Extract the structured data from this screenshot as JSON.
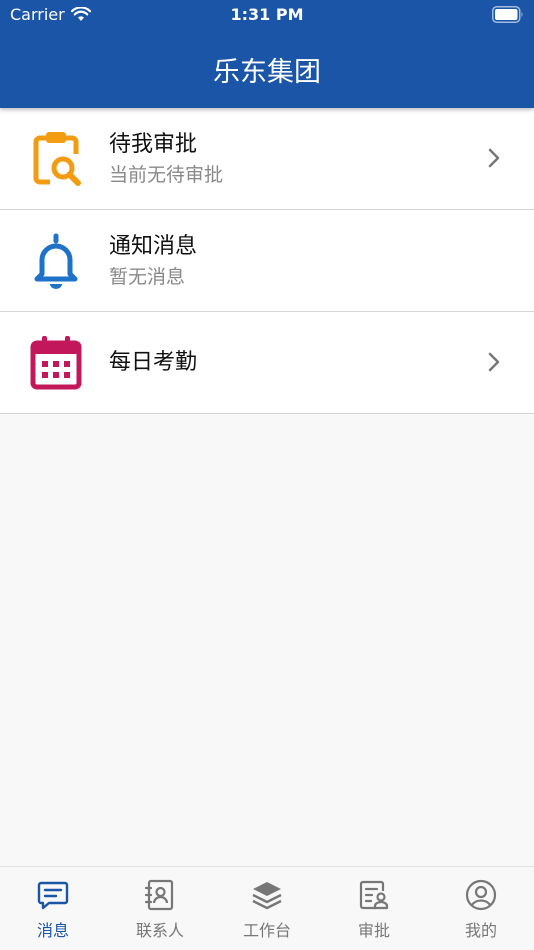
{
  "status_bar": {
    "carrier": "Carrier",
    "time": "1:31 PM"
  },
  "header": {
    "title": "乐东集团"
  },
  "list": [
    {
      "label": "待我审批",
      "sub": "当前无待审批",
      "icon": "clipboard-search-icon",
      "color": "#f39c12",
      "has_chevron": true
    },
    {
      "label": "通知消息",
      "sub": "暂无消息",
      "icon": "bell-icon",
      "color": "#1e72c8",
      "has_chevron": false
    },
    {
      "label": "每日考勤",
      "sub": "",
      "icon": "calendar-icon",
      "color": "#c2185b",
      "has_chevron": true
    }
  ],
  "tabs": [
    {
      "label": "消息",
      "icon": "message-icon",
      "active": true
    },
    {
      "label": "联系人",
      "icon": "contacts-icon",
      "active": false
    },
    {
      "label": "工作台",
      "icon": "layers-icon",
      "active": false
    },
    {
      "label": "审批",
      "icon": "approval-icon",
      "active": false
    },
    {
      "label": "我的",
      "icon": "profile-icon",
      "active": false
    }
  ],
  "colors": {
    "primary": "#1a55a8",
    "inactive": "#777777"
  }
}
